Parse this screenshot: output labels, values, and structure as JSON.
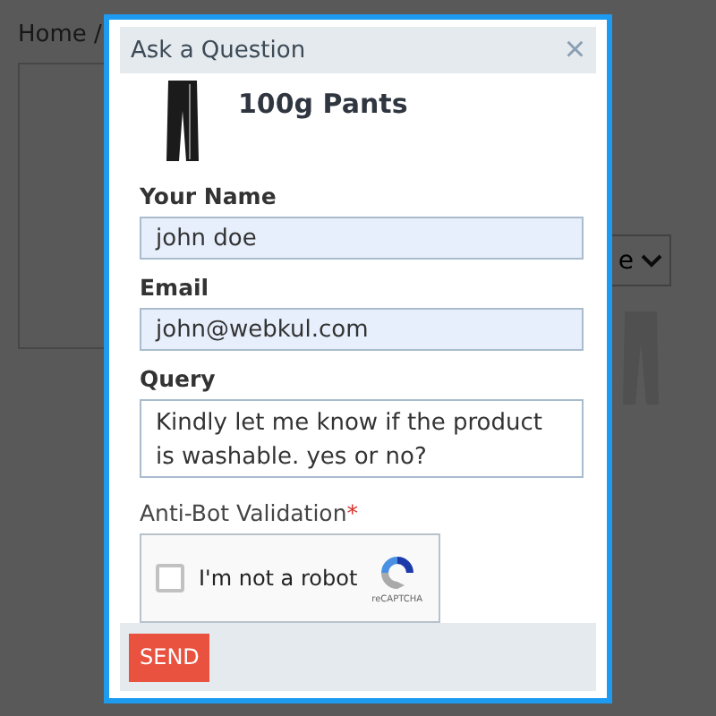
{
  "background": {
    "breadcrumb": "Home /",
    "select_value": "e"
  },
  "dialog": {
    "title": "Ask a Question",
    "close": "×",
    "product": {
      "name": "100g Pants"
    },
    "fields": [
      {
        "kind": "input",
        "label": "Your Name",
        "value": "john doe"
      },
      {
        "kind": "input",
        "label": "Email",
        "value": "john@webkul.com"
      },
      {
        "kind": "textarea",
        "label": "Query",
        "value": "Kindly let me know if the product is washable. yes or no?"
      }
    ],
    "captcha": {
      "label": "Anti-Bot Validation",
      "required_mark": "*",
      "checkbox_label": "I'm not a robot",
      "checked": false,
      "brand": "reCAPTCHA"
    },
    "buttons": [
      "SEND"
    ]
  }
}
